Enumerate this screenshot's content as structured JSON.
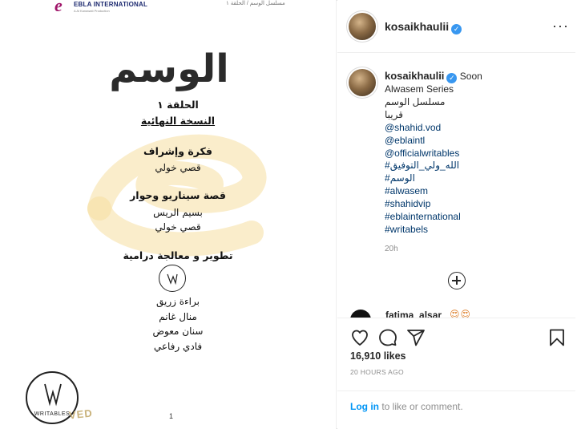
{
  "document": {
    "company_name": "EBLA INTERNATIONAL",
    "company_sub": "A Al Kanawati Production",
    "header_right": "مسلسل الوسم / الحلقة ١",
    "title": "الوسم",
    "episode": "الحلقة ١",
    "version": "النسخة النهائية",
    "idea_heading": "فكرة وإشراف",
    "idea_name": "قصي خولي",
    "story_heading": "قصة سيناريو وحوار",
    "story_name_1": "بسيم الريس",
    "story_name_2": "قصي خولي",
    "dev_heading": "تطوير و معالجة درامية",
    "dev_name_1": "براءة زريق",
    "dev_name_2": "منال غانم",
    "dev_name_3": "سنان معوض",
    "dev_name_4": "فادي رفاعي",
    "writables_label": "WRITABLES",
    "stamp_text": "VED",
    "page_number": "1"
  },
  "post": {
    "username": "kosaikhaulii",
    "more_icon": "more-options-icon",
    "caption": {
      "first_line": "Soon",
      "lines": [
        "Alwasem Series",
        "مسلسل الوسم",
        "قريبا",
        "@shahid.vod",
        "@eblaintl",
        "@officialwritables",
        "#الله_ولي_التوفيق",
        "#الوسم",
        "#alwasem",
        "#shahidvip",
        "#eblainternational",
        "#writabels"
      ]
    },
    "time_ago": "20h",
    "peek_comment_user": "fatima_alsar",
    "peek_comment_emoji": "😍😍",
    "likes": "16,910 likes",
    "timestamp": "20 HOURS AGO",
    "login_link": "Log in",
    "login_rest": " to like or comment."
  },
  "colors": {
    "verified": "#3897f0",
    "link": "#00376b",
    "login_link": "#0095f6",
    "watermark": "#f3d98a",
    "brand": "#a0166a"
  }
}
